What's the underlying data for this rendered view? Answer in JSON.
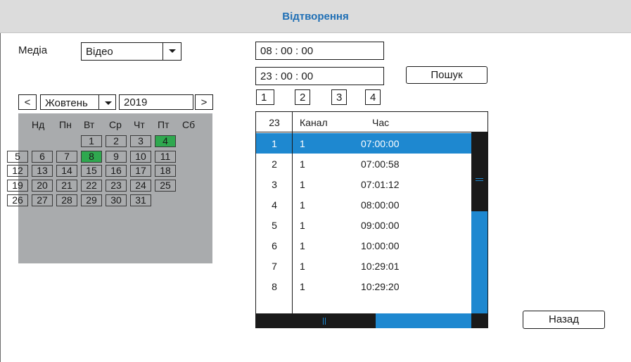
{
  "title": "Відтворення",
  "media": {
    "label": "Медіа",
    "value": "Відео"
  },
  "time": {
    "start": "08 : 00 : 00",
    "end": "23 : 00 : 00"
  },
  "search_label": "Пошук",
  "channels": [
    "1",
    "2",
    "3",
    "4"
  ],
  "calendar": {
    "prev": "<",
    "next": ">",
    "month": "Жовтень",
    "year": "2019",
    "weekdays": [
      "Нд",
      "Пн",
      "Вт",
      "Ср",
      "Чт",
      "Пт",
      "Сб"
    ],
    "selected_day": "8",
    "marked_day": "4",
    "days": [
      "1",
      "2",
      "3",
      "4",
      "5",
      "6",
      "7",
      "8",
      "9",
      "10",
      "11",
      "12",
      "13",
      "14",
      "15",
      "16",
      "17",
      "18",
      "19",
      "20",
      "21",
      "22",
      "23",
      "24",
      "25",
      "26",
      "27",
      "28",
      "29",
      "30",
      "31"
    ]
  },
  "table": {
    "count": "23",
    "columns": [
      "Канал",
      "Час"
    ],
    "rows": [
      {
        "index": "1",
        "channel": "1",
        "time": "07:00:00"
      },
      {
        "index": "2",
        "channel": "1",
        "time": "07:00:58"
      },
      {
        "index": "3",
        "channel": "1",
        "time": "07:01:12"
      },
      {
        "index": "4",
        "channel": "1",
        "time": "08:00:00"
      },
      {
        "index": "5",
        "channel": "1",
        "time": "09:00:00"
      },
      {
        "index": "6",
        "channel": "1",
        "time": "10:00:00"
      },
      {
        "index": "7",
        "channel": "1",
        "time": "10:29:01"
      },
      {
        "index": "8",
        "channel": "1",
        "time": "10:29:20"
      }
    ],
    "selected_row": 0
  },
  "back_label": "Назад",
  "colors": {
    "accent": "#1e88d0",
    "title_text": "#1f6fb5",
    "day_highlight": "#2fa84f",
    "calendar_bg": "#a9abad"
  }
}
